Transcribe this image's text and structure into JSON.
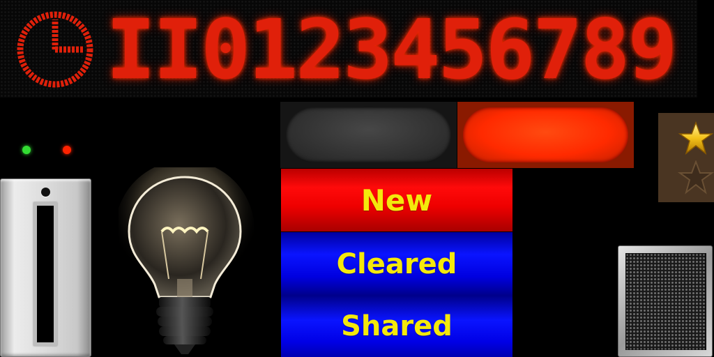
{
  "led_display": {
    "icon": "clock-icon",
    "text": "II0123456789",
    "color": "#e0200a"
  },
  "status_lights": [
    {
      "name": "green-led",
      "color": "#33dd33"
    },
    {
      "name": "red-led",
      "color": "#ff2200"
    }
  ],
  "toggle": {
    "off_color": "#3a3a3a",
    "on_color": "#ff3300"
  },
  "labels": {
    "new": "New",
    "cleared": "Cleared",
    "shared": "Shared"
  },
  "rating": {
    "filled_icon": "star-filled-icon",
    "empty_icon": "star-empty-icon"
  },
  "icons": [
    "clock-icon",
    "light-bulb-icon",
    "light-switch-plate",
    "speaker-grille-icon"
  ]
}
